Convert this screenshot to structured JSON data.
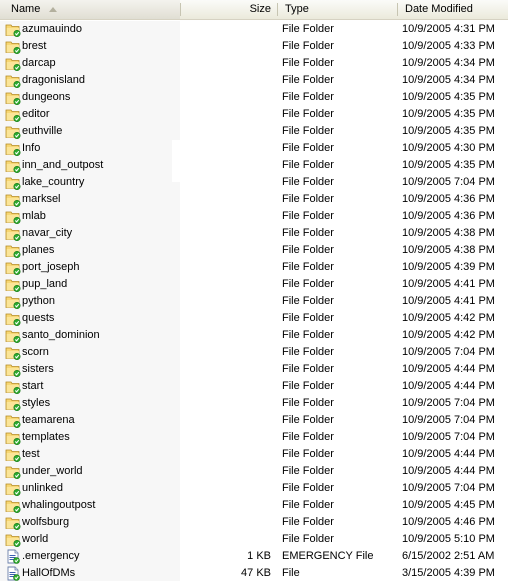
{
  "header": {
    "columns": [
      {
        "label": "Name",
        "sorted": true,
        "sort_dir": "ascending"
      },
      {
        "label": "Size"
      },
      {
        "label": "Type"
      },
      {
        "label": "Date Modified"
      }
    ]
  },
  "icons": {
    "folder": "folder-icon",
    "file": "file-icon"
  },
  "files": [
    {
      "name": "azumauindo",
      "size": "",
      "type": "File Folder",
      "date": "10/9/2005 4:31 PM",
      "icon": "folder"
    },
    {
      "name": "brest",
      "size": "",
      "type": "File Folder",
      "date": "10/9/2005 4:33 PM",
      "icon": "folder"
    },
    {
      "name": "darcap",
      "size": "",
      "type": "File Folder",
      "date": "10/9/2005 4:34 PM",
      "icon": "folder"
    },
    {
      "name": "dragonisland",
      "size": "",
      "type": "File Folder",
      "date": "10/9/2005 4:34 PM",
      "icon": "folder"
    },
    {
      "name": "dungeons",
      "size": "",
      "type": "File Folder",
      "date": "10/9/2005 4:35 PM",
      "icon": "folder"
    },
    {
      "name": "editor",
      "size": "",
      "type": "File Folder",
      "date": "10/9/2005 4:35 PM",
      "icon": "folder"
    },
    {
      "name": "euthville",
      "size": "",
      "type": "File Folder",
      "date": "10/9/2005 4:35 PM",
      "icon": "folder"
    },
    {
      "name": "Info",
      "size": "",
      "type": "File Folder",
      "date": "10/9/2005 4:30 PM",
      "icon": "folder"
    },
    {
      "name": "inn_and_outpost",
      "size": "",
      "type": "File Folder",
      "date": "10/9/2005 4:35 PM",
      "icon": "folder"
    },
    {
      "name": "lake_country",
      "size": "",
      "type": "File Folder",
      "date": "10/9/2005 7:04 PM",
      "icon": "folder"
    },
    {
      "name": "marksel",
      "size": "",
      "type": "File Folder",
      "date": "10/9/2005 4:36 PM",
      "icon": "folder"
    },
    {
      "name": "mlab",
      "size": "",
      "type": "File Folder",
      "date": "10/9/2005 4:36 PM",
      "icon": "folder"
    },
    {
      "name": "navar_city",
      "size": "",
      "type": "File Folder",
      "date": "10/9/2005 4:38 PM",
      "icon": "folder"
    },
    {
      "name": "planes",
      "size": "",
      "type": "File Folder",
      "date": "10/9/2005 4:38 PM",
      "icon": "folder"
    },
    {
      "name": "port_joseph",
      "size": "",
      "type": "File Folder",
      "date": "10/9/2005 4:39 PM",
      "icon": "folder"
    },
    {
      "name": "pup_land",
      "size": "",
      "type": "File Folder",
      "date": "10/9/2005 4:41 PM",
      "icon": "folder"
    },
    {
      "name": "python",
      "size": "",
      "type": "File Folder",
      "date": "10/9/2005 4:41 PM",
      "icon": "folder"
    },
    {
      "name": "quests",
      "size": "",
      "type": "File Folder",
      "date": "10/9/2005 4:42 PM",
      "icon": "folder"
    },
    {
      "name": "santo_dominion",
      "size": "",
      "type": "File Folder",
      "date": "10/9/2005 4:42 PM",
      "icon": "folder"
    },
    {
      "name": "scorn",
      "size": "",
      "type": "File Folder",
      "date": "10/9/2005 7:04 PM",
      "icon": "folder"
    },
    {
      "name": "sisters",
      "size": "",
      "type": "File Folder",
      "date": "10/9/2005 4:44 PM",
      "icon": "folder"
    },
    {
      "name": "start",
      "size": "",
      "type": "File Folder",
      "date": "10/9/2005 4:44 PM",
      "icon": "folder"
    },
    {
      "name": "styles",
      "size": "",
      "type": "File Folder",
      "date": "10/9/2005 7:04 PM",
      "icon": "folder"
    },
    {
      "name": "teamarena",
      "size": "",
      "type": "File Folder",
      "date": "10/9/2005 7:04 PM",
      "icon": "folder"
    },
    {
      "name": "templates",
      "size": "",
      "type": "File Folder",
      "date": "10/9/2005 7:04 PM",
      "icon": "folder"
    },
    {
      "name": "test",
      "size": "",
      "type": "File Folder",
      "date": "10/9/2005 4:44 PM",
      "icon": "folder"
    },
    {
      "name": "under_world",
      "size": "",
      "type": "File Folder",
      "date": "10/9/2005 4:44 PM",
      "icon": "folder"
    },
    {
      "name": "unlinked",
      "size": "",
      "type": "File Folder",
      "date": "10/9/2005 7:04 PM",
      "icon": "folder"
    },
    {
      "name": "whalingoutpost",
      "size": "",
      "type": "File Folder",
      "date": "10/9/2005 4:45 PM",
      "icon": "folder"
    },
    {
      "name": "wolfsburg",
      "size": "",
      "type": "File Folder",
      "date": "10/9/2005 4:46 PM",
      "icon": "folder"
    },
    {
      "name": "world",
      "size": "",
      "type": "File Folder",
      "date": "10/9/2005 5:10 PM",
      "icon": "folder"
    },
    {
      "name": ".emergency",
      "size": "1 KB",
      "type": "EMERGENCY File",
      "date": "6/15/2002 2:51 AM",
      "icon": "file"
    },
    {
      "name": "HallOfDMs",
      "size": "47 KB",
      "type": "File",
      "date": "3/15/2005 4:39 PM",
      "icon": "file"
    }
  ]
}
